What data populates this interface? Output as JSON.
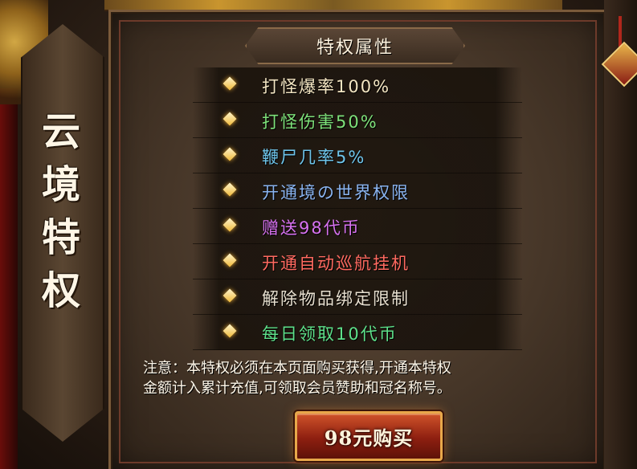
{
  "side_title": [
    "云",
    "境",
    "特",
    "权"
  ],
  "header": {
    "title": "特权属性"
  },
  "privileges": [
    {
      "text": "打怪爆率100%",
      "color": "#f3e5c2"
    },
    {
      "text": "打怪伤害50%",
      "color": "#7ee17a"
    },
    {
      "text": "鞭尸几率5%",
      "color": "#6ec4ea"
    },
    {
      "text": "开通境の世界权限",
      "color": "#8ab4f0"
    },
    {
      "text": "赠送98代币",
      "color": "#d772f0"
    },
    {
      "text": "开通自动巡航挂机",
      "color": "#ff6a60"
    },
    {
      "text": "解除物品绑定限制",
      "color": "#e8e0d0"
    },
    {
      "text": "每日领取10代币",
      "color": "#5ee08a"
    }
  ],
  "notice": {
    "line1": "注意：本特权必须在本页面购买获得,开通本特权",
    "line2": "金额计入累计充值,可领取会员赞助和冠名称号。"
  },
  "buy_button": {
    "label": "98元购买"
  },
  "icons": {
    "bullet": "diamond-bullet-icon",
    "corner_left": "dragon-ornament-icon",
    "corner_right": "tassel-ornament-icon"
  }
}
